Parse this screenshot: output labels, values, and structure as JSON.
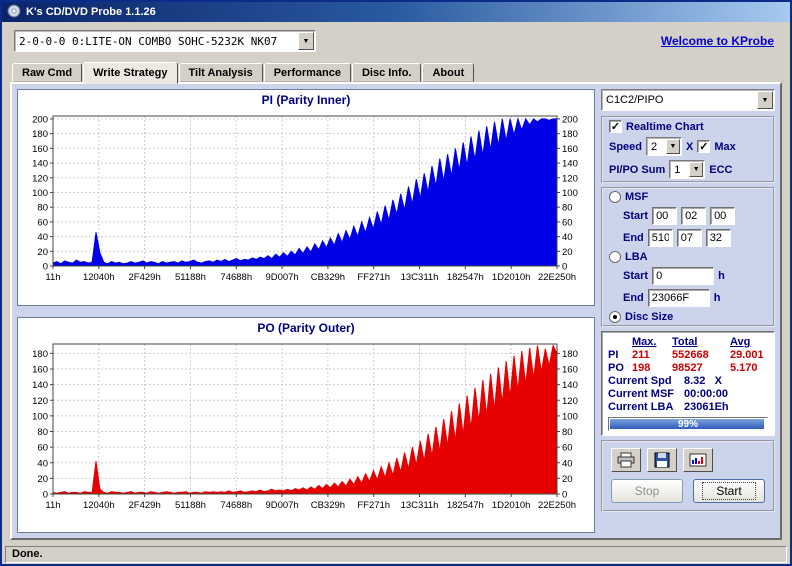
{
  "window": {
    "title": "K's CD/DVD Probe 1.1.26",
    "status_text": "Done."
  },
  "toolbar": {
    "device_selector": "2-0-0-0 0:LITE-ON COMBO SOHC-5232K NK07",
    "welcome_link": "Welcome to KProbe"
  },
  "tabs": {
    "items": [
      "Raw Cmd",
      "Write Strategy",
      "Tilt Analysis",
      "Performance",
      "Disc Info.",
      "About"
    ],
    "active": "Write Strategy"
  },
  "chart_data": [
    {
      "type": "area",
      "title": "PI (Parity Inner)",
      "color": "#0000e6",
      "categories": [
        "11h",
        "12040h",
        "2F429h",
        "51188h",
        "74688h",
        "9D007h",
        "CB329h",
        "FF271h",
        "13C311h",
        "182547h",
        "1D2010h",
        "22E250h"
      ],
      "values": [
        4,
        6,
        3,
        7,
        5,
        4,
        8,
        5,
        6,
        4,
        5,
        46,
        18,
        5,
        3,
        6,
        4,
        5,
        3,
        4,
        6,
        4,
        5,
        7,
        4,
        6,
        5,
        3,
        6,
        4,
        5,
        6,
        4,
        7,
        5,
        6,
        8,
        5,
        4,
        6,
        7,
        5,
        8,
        6,
        9,
        6,
        8,
        10,
        7,
        9,
        8,
        11,
        9,
        12,
        10,
        14,
        10,
        16,
        12,
        18,
        13,
        20,
        15,
        24,
        17,
        26,
        19,
        30,
        22,
        34,
        25,
        38,
        28,
        44,
        32,
        48,
        36,
        54,
        40,
        60,
        45,
        66,
        50,
        74,
        56,
        82,
        62,
        90,
        70,
        98,
        76,
        108,
        84,
        118,
        92,
        126,
        100,
        136,
        108,
        146,
        115,
        152,
        122,
        160,
        130,
        168,
        136,
        176,
        144,
        184,
        150,
        190,
        158,
        196,
        164,
        200,
        170,
        200,
        178,
        200,
        185,
        200,
        192,
        200,
        196,
        200,
        200,
        198,
        200,
        200
      ],
      "ylim": [
        0,
        204
      ],
      "yticks": [
        0,
        20,
        40,
        60,
        80,
        100,
        120,
        140,
        160,
        180,
        200
      ],
      "grid": true,
      "xlabel": "",
      "ylabel": ""
    },
    {
      "type": "area",
      "title": "PO (Parity Outer)",
      "color": "#e60000",
      "categories": [
        "11h",
        "12040h",
        "2F429h",
        "51188h",
        "74688h",
        "9D007h",
        "CB329h",
        "FF271h",
        "13C311h",
        "182547h",
        "1D2010h",
        "22E250h"
      ],
      "values": [
        2,
        1,
        2,
        3,
        1,
        2,
        2,
        1,
        3,
        2,
        2,
        42,
        6,
        2,
        1,
        3,
        2,
        2,
        1,
        2,
        3,
        1,
        2,
        2,
        1,
        3,
        2,
        1,
        2,
        3,
        2,
        1,
        2,
        2,
        3,
        1,
        2,
        2,
        1,
        3,
        2,
        3,
        2,
        3,
        2,
        4,
        2,
        3,
        4,
        2,
        3,
        4,
        3,
        5,
        3,
        4,
        6,
        4,
        5,
        4,
        6,
        4,
        7,
        5,
        8,
        5,
        9,
        6,
        11,
        7,
        12,
        8,
        14,
        9,
        16,
        10,
        19,
        12,
        22,
        14,
        26,
        16,
        30,
        18,
        35,
        21,
        40,
        24,
        46,
        28,
        53,
        32,
        60,
        37,
        68,
        42,
        77,
        48,
        86,
        54,
        96,
        61,
        106,
        68,
        116,
        76,
        126,
        84,
        136,
        92,
        146,
        100,
        154,
        108,
        162,
        116,
        170,
        124,
        177,
        132,
        183,
        140,
        187,
        148,
        190,
        156,
        186,
        164,
        190,
        180
      ],
      "ylim": [
        0,
        192
      ],
      "yticks": [
        0,
        20,
        40,
        60,
        80,
        100,
        120,
        140,
        160,
        180
      ],
      "grid": true,
      "xlabel": "",
      "ylabel": ""
    }
  ],
  "controls": {
    "mode_select": "C1C2/PIPO",
    "realtime_chart_label": "Realtime Chart",
    "realtime_checked": true,
    "check_glyph": "✓",
    "speed_label": "Speed",
    "speed_value": "2",
    "speed_x_label": "X",
    "max_label": "Max",
    "max_checked": true,
    "pipo_sum_label": "PI/PO Sum",
    "pipo_sum_value": "1",
    "ecc_label": "ECC",
    "msf_label": "MSF",
    "msf_start_label": "Start",
    "msf_start": [
      "00",
      "02",
      "00"
    ],
    "msf_end_label": "End",
    "msf_end": [
      "510",
      "07",
      "32"
    ],
    "lba_label": "LBA",
    "lba_start_label": "Start",
    "lba_start_value": "0",
    "lba_start_unit": "h",
    "lba_end_label": "End",
    "lba_end_value": "23066F",
    "lba_end_unit": "h",
    "disc_size_label": "Disc Size",
    "selected_range": "Disc Size"
  },
  "stats": {
    "headers": {
      "max": "Max.",
      "total": "Total",
      "avg": "Avg"
    },
    "rows": [
      {
        "label": "PI",
        "max": "211",
        "total": "552668",
        "avg": "29.001"
      },
      {
        "label": "PO",
        "max": "198",
        "total": "98527",
        "avg": "5.170"
      }
    ],
    "current_spd_label": "Current Spd",
    "current_spd_value": "8.32",
    "current_spd_unit": "X",
    "current_msf_label": "Current MSF",
    "current_msf_value": "00:00:00",
    "current_lba_label": "Current LBA",
    "current_lba_value": "23061Eh",
    "progress_percent": 99,
    "progress_label": "99%"
  },
  "actions": {
    "stop_label": "Stop",
    "start_label": "Start"
  },
  "icons": {
    "app": "app-icon",
    "dropdown": "chevron-down-icon",
    "print": "printer-icon",
    "save": "save-icon",
    "snapshot": "snapshot-icon"
  }
}
